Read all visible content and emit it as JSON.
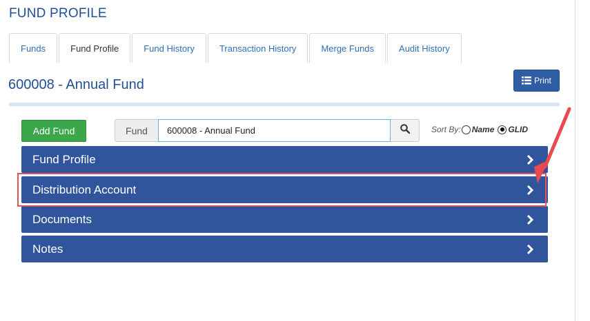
{
  "page": {
    "title": "FUND PROFILE"
  },
  "tabs": [
    {
      "label": "Funds",
      "active": false
    },
    {
      "label": "Fund Profile",
      "active": true
    },
    {
      "label": "Fund History",
      "active": false
    },
    {
      "label": "Transaction History",
      "active": false
    },
    {
      "label": "Merge Funds",
      "active": false
    },
    {
      "label": "Audit History",
      "active": false
    }
  ],
  "fund": {
    "heading": "600008 - Annual Fund"
  },
  "toolbar": {
    "print_label": "Print",
    "add_fund_label": "Add Fund",
    "fund_label": "Fund",
    "fund_value": "600008 - Annual Fund",
    "sort_by_label": "Sort By:",
    "sort_options": [
      {
        "label": "Name",
        "checked": false
      },
      {
        "label": "GLID",
        "checked": true
      }
    ]
  },
  "panels": [
    {
      "label": "Fund Profile"
    },
    {
      "label": "Distribution Account"
    },
    {
      "label": "Documents"
    },
    {
      "label": "Notes"
    }
  ],
  "icons": {
    "print": "list-icon",
    "search": "search-icon",
    "panel_toggle": "chevron-right-icon",
    "annotation": "arrow-annotation"
  },
  "colors": {
    "brand_blue": "#1f4f96",
    "panel_blue": "#30559c",
    "add_green": "#3ca64a",
    "highlight_red": "#e0525d"
  }
}
